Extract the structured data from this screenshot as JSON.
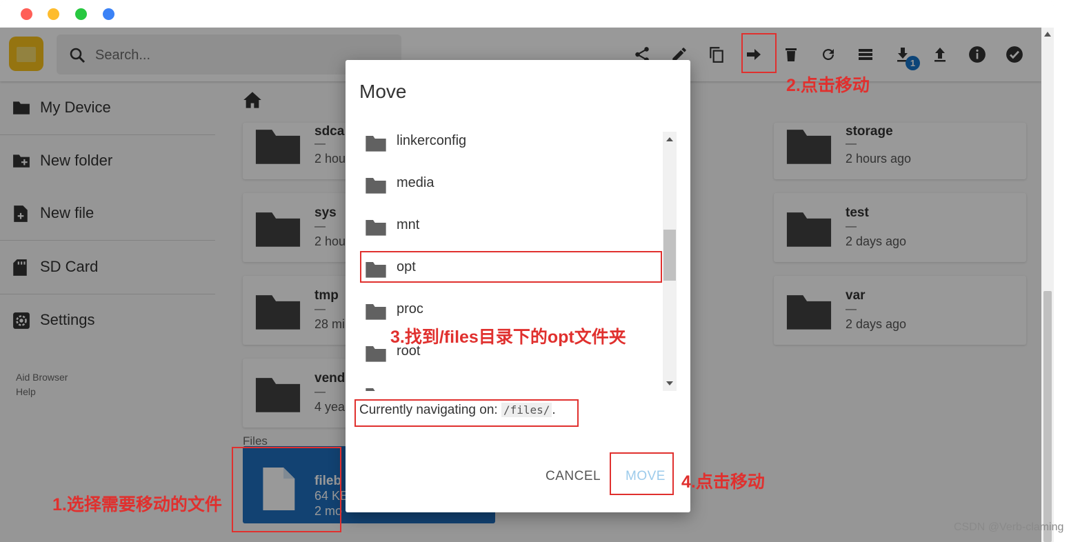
{
  "window": {
    "traffic_lights": {
      "close": "#ff5f57",
      "minimize": "#febc2e",
      "zoom": "#28c840",
      "extra": "#3b82f6"
    }
  },
  "header": {
    "search_placeholder": "Search...",
    "download_badge": "1",
    "toolbar_icons": [
      "share-icon",
      "edit-icon",
      "copy-icon",
      "move-icon",
      "delete-icon",
      "refresh-icon",
      "view-list-icon",
      "download-icon",
      "upload-icon",
      "info-icon",
      "select-check-icon"
    ]
  },
  "sidebar": {
    "items": [
      {
        "label": "My Device",
        "icon": "folder-icon"
      },
      {
        "label": "New folder",
        "icon": "create-folder-icon"
      },
      {
        "label": "New file",
        "icon": "note-add-icon"
      },
      {
        "label": "SD Card",
        "icon": "sd-card-icon"
      },
      {
        "label": "Settings",
        "icon": "settings-icon"
      }
    ],
    "credits": [
      "Aid Browser",
      "Help"
    ]
  },
  "listing": {
    "cards": [
      {
        "name": "sdca",
        "size": "—",
        "date": "2 hou"
      },
      {
        "name": "storage",
        "size": "—",
        "date": "2 hours ago"
      },
      {
        "name": "sys",
        "size": "—",
        "date": "2 hou"
      },
      {
        "name": "test",
        "size": "—",
        "date": "2 days ago"
      },
      {
        "name": "tmp",
        "size": "—",
        "date": "28 mi"
      },
      {
        "name": "var",
        "size": "—",
        "date": "2 days ago"
      },
      {
        "name": "vend",
        "size": "—",
        "date": "4 year"
      }
    ],
    "files_section_label": "Files",
    "file_card": {
      "name": "fileb",
      "size": "64 KE",
      "date": "2 mo"
    }
  },
  "dialog": {
    "title": "Move",
    "folders": [
      "linkerconfig",
      "media",
      "mnt",
      "opt",
      "proc",
      "root"
    ],
    "navigating_prefix": "Currently navigating on: ",
    "navigating_path": "/files/",
    "navigating_suffix": ".",
    "cancel_label": "CANCEL",
    "move_label": "MOVE"
  },
  "annotations": {
    "step1": "1.选择需要移动的文件",
    "step2": "2.点击移动",
    "step3": "3.找到/files目录下的opt文件夹",
    "step4": "4.点击移动",
    "color": "#e0302e"
  },
  "watermark": "CSDN @Verb-claming"
}
